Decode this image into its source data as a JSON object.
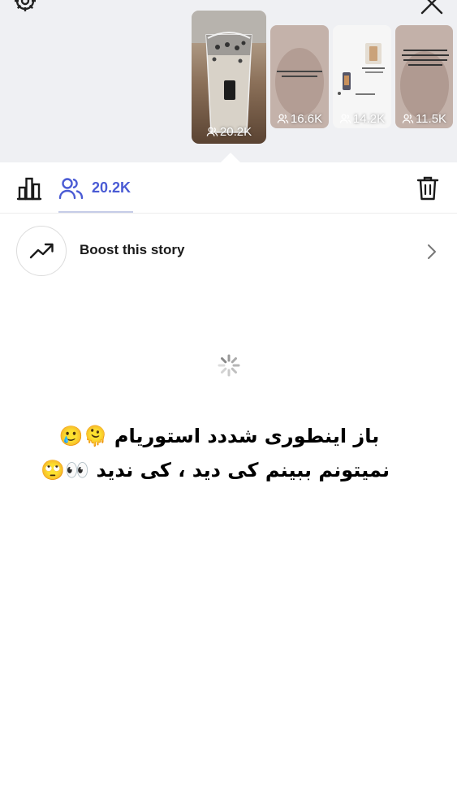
{
  "header": {
    "settings_icon": "gear-icon",
    "close_icon": "close-icon"
  },
  "stories": [
    {
      "count": "20.2K",
      "selected": true
    },
    {
      "count": "16.6K",
      "selected": false
    },
    {
      "count": "14.2K",
      "selected": false
    },
    {
      "count": "11.5K",
      "selected": false
    }
  ],
  "toolbar": {
    "insights_icon": "bar-chart-icon",
    "viewers_icon": "people-icon",
    "viewers_count": "20.2K",
    "delete_icon": "trash-icon"
  },
  "boost": {
    "label": "Boost this story",
    "icon": "trending-up-icon"
  },
  "caption": {
    "line1": "باز اینطوری شددد استوریام 🫠🥲",
    "line2": "نمیتونم ببینم کی دید ، کی ندید 👀🙄"
  },
  "colors": {
    "accent": "#4a5bd4",
    "top_background": "#eff0f3"
  }
}
